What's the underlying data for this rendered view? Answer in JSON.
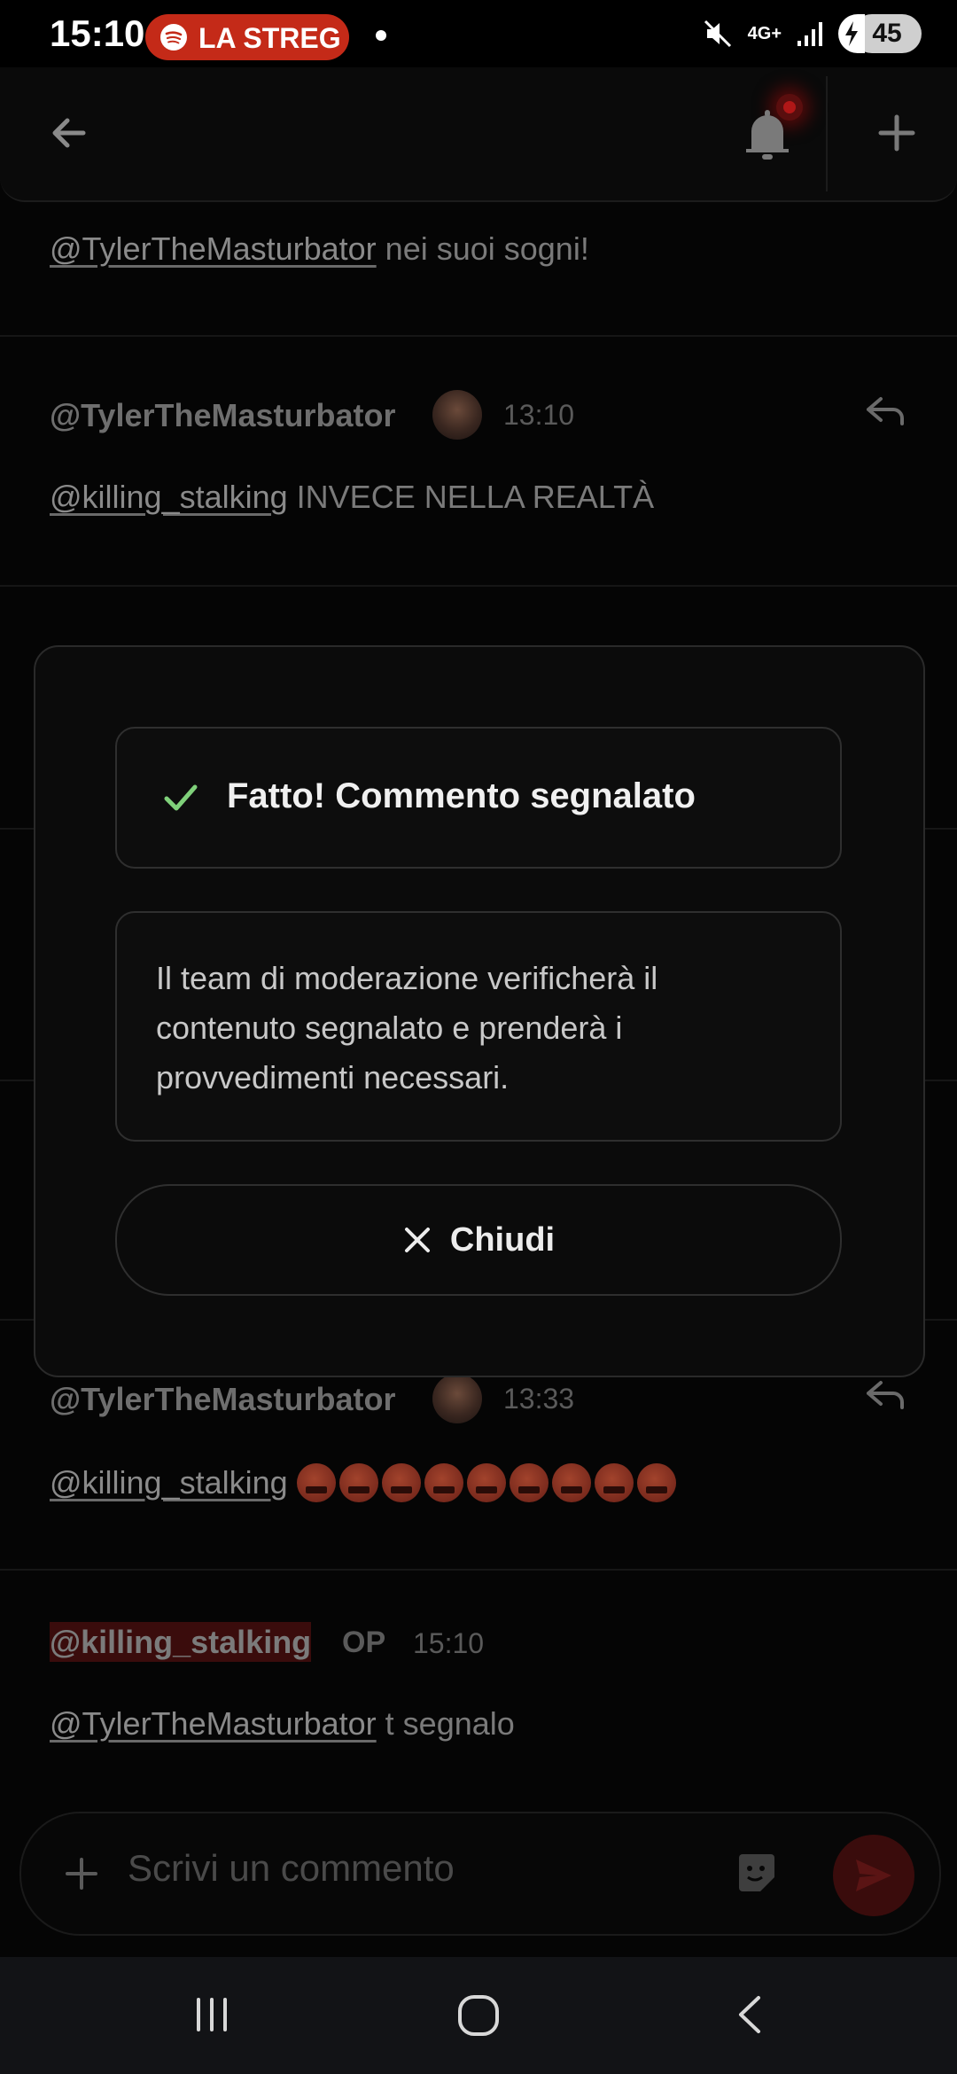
{
  "status_bar": {
    "time": "15:10",
    "spotify_label": "LA STREG",
    "network": "4G+",
    "battery": "45"
  },
  "comments": [
    {
      "mention": "@TylerTheMasturbator",
      "text": " nei suoi sogni!"
    },
    {
      "author": "@TylerTheMasturbator",
      "time": "13:10",
      "mention": "@killing_stalking",
      "text": " INVECE NELLA REALTÀ"
    },
    {
      "author": "@TylerTheMasturbator",
      "time": "13:33",
      "mention": "@killing_stalking",
      "emoji_count": 9,
      "emoji_icon": "cursing-face-icon"
    },
    {
      "author": "@killing_stalking",
      "badge": "OP",
      "time": "15:10",
      "mention": "@TylerTheMasturbator",
      "text": " t segnalo"
    }
  ],
  "dialog": {
    "title": "Fatto! Commento segnalato",
    "message": "Il team di moderazione verificherà il contenuto segnalato e prenderà i provvedimenti necessari.",
    "close_label": "Chiudi",
    "accent": "#7fd07a"
  },
  "composer": {
    "placeholder": "Scrivi un commento"
  },
  "colors": {
    "spotify_pill": "#c42a18",
    "notification_dot": "#b01717",
    "op_highlight": "#3a0c0c"
  }
}
